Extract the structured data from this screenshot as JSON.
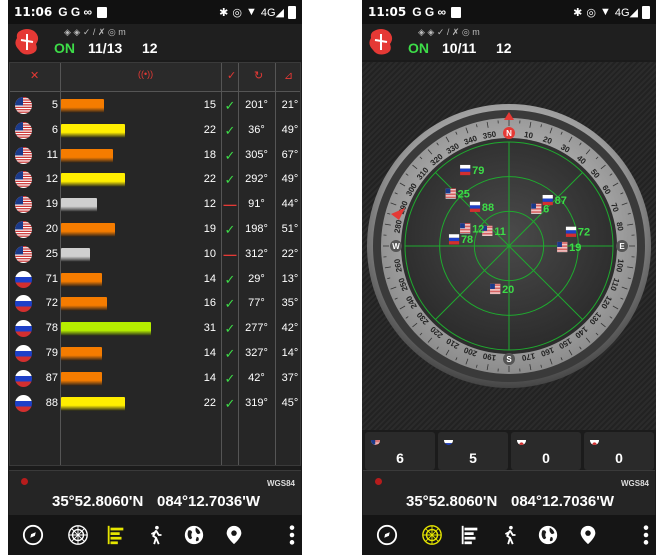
{
  "left": {
    "status": {
      "time": "11:06",
      "icons": "G G ∞"
    },
    "header": {
      "icons": "◈ ◈   ✓ / ✗   ◎ m",
      "fix": "ON",
      "sats": "11/13",
      "alt": "12"
    },
    "columns": [
      "sat-icon",
      "signal-icon",
      "used-icon",
      "azimuth-icon",
      "elevation-icon"
    ],
    "rows": [
      {
        "flag": "us",
        "prn": "5",
        "snr": "15",
        "bar": 0.36,
        "color": "#f57c00",
        "used": "✓",
        "az": "201°",
        "el": "21°"
      },
      {
        "flag": "us",
        "prn": "6",
        "snr": "22",
        "bar": 0.53,
        "color": "#ffee00",
        "used": "✓",
        "az": "36°",
        "el": "49°"
      },
      {
        "flag": "us",
        "prn": "11",
        "snr": "18",
        "bar": 0.43,
        "color": "#f57c00",
        "used": "✓",
        "az": "305°",
        "el": "67°"
      },
      {
        "flag": "us",
        "prn": "12",
        "snr": "22",
        "bar": 0.53,
        "color": "#ffee00",
        "used": "✓",
        "az": "292°",
        "el": "49°"
      },
      {
        "flag": "us",
        "prn": "19",
        "snr": "12",
        "bar": 0.3,
        "color": "#cfcfcf",
        "used": "—",
        "az": "91°",
        "el": "44°"
      },
      {
        "flag": "us",
        "prn": "20",
        "snr": "19",
        "bar": 0.45,
        "color": "#f57c00",
        "used": "✓",
        "az": "198°",
        "el": "51°"
      },
      {
        "flag": "us",
        "prn": "25",
        "snr": "10",
        "bar": 0.24,
        "color": "#cfcfcf",
        "used": "—",
        "az": "312°",
        "el": "22°"
      },
      {
        "flag": "ru",
        "prn": "71",
        "snr": "14",
        "bar": 0.34,
        "color": "#f57c00",
        "used": "✓",
        "az": "29°",
        "el": "13°"
      },
      {
        "flag": "ru",
        "prn": "72",
        "snr": "16",
        "bar": 0.38,
        "color": "#f57c00",
        "used": "✓",
        "az": "77°",
        "el": "35°"
      },
      {
        "flag": "ru",
        "prn": "78",
        "snr": "31",
        "bar": 0.75,
        "color": "#b6ee00",
        "used": "✓",
        "az": "277°",
        "el": "42°"
      },
      {
        "flag": "ru",
        "prn": "79",
        "snr": "14",
        "bar": 0.34,
        "color": "#f57c00",
        "used": "✓",
        "az": "327°",
        "el": "14°"
      },
      {
        "flag": "ru",
        "prn": "87",
        "snr": "14",
        "bar": 0.34,
        "color": "#f57c00",
        "used": "✓",
        "az": "42°",
        "el": "37°"
      },
      {
        "flag": "ru",
        "prn": "88",
        "snr": "22",
        "bar": 0.53,
        "color": "#ffee00",
        "used": "✓",
        "az": "319°",
        "el": "45°"
      }
    ],
    "coords": {
      "datum": "WGS84",
      "lat": "35°52.8060'N",
      "lon": "084°12.7036'W"
    }
  },
  "right": {
    "status": {
      "time": "11:05",
      "icons": "G G ∞"
    },
    "header": {
      "icons": "◈ ◈   ✓ / ✗   ◎ m",
      "fix": "ON",
      "sats": "10/11",
      "alt": "12"
    },
    "compass_labels": [
      "10",
      "20",
      "30",
      "40",
      "50",
      "60",
      "70",
      "80",
      "100",
      "110",
      "120",
      "130",
      "140",
      "150",
      "160",
      "170",
      "190",
      "200",
      "210",
      "220",
      "230",
      "240",
      "250",
      "260",
      "280",
      "290",
      "300",
      "310",
      "320",
      "330",
      "340",
      "350"
    ],
    "cardinals": [
      "N",
      "E",
      "S",
      "W"
    ],
    "sats": [
      {
        "flag": "ru",
        "prn": "87",
        "az": 40,
        "el": 38
      },
      {
        "flag": "us",
        "prn": "6",
        "az": 36,
        "el": 50
      },
      {
        "flag": "ru",
        "prn": "72",
        "az": 77,
        "el": 35
      },
      {
        "flag": "us",
        "prn": "19",
        "az": 91,
        "el": 44
      },
      {
        "flag": "ru",
        "prn": "79",
        "az": 330,
        "el": 14
      },
      {
        "flag": "ru",
        "prn": "88",
        "az": 319,
        "el": 45
      },
      {
        "flag": "us",
        "prn": "11",
        "az": 305,
        "el": 67
      },
      {
        "flag": "us",
        "prn": "25",
        "az": 312,
        "el": 22
      },
      {
        "flag": "us",
        "prn": "12",
        "az": 292,
        "el": 49
      },
      {
        "flag": "us",
        "prn": "20",
        "az": 198,
        "el": 51
      },
      {
        "flag": "ru",
        "prn": "78",
        "az": 277,
        "el": 42
      }
    ],
    "counts": [
      {
        "flag": "us",
        "value": "6"
      },
      {
        "flag": "ru",
        "value": "5"
      },
      {
        "flag": "jp",
        "value": "0"
      },
      {
        "flag": "jp",
        "value": "0"
      }
    ],
    "coords": {
      "datum": "WGS84",
      "lat": "35°52.8060'N",
      "lon": "084°12.7036'W"
    }
  },
  "nav": [
    "compass-icon",
    "radar-icon",
    "signal-bars-icon",
    "walker-icon",
    "globe-icon",
    "location-pin-icon",
    "more-vert-icon"
  ]
}
